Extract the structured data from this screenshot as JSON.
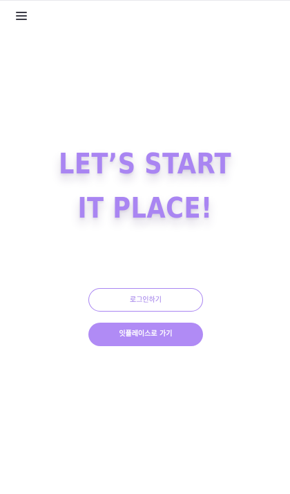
{
  "header": {
    "menu_icon": "hamburger-menu-icon"
  },
  "hero": {
    "line1": "LET’S START",
    "line2": "IT PLACE!"
  },
  "actions": {
    "login_label": "로그인하기",
    "go_label": "잇플레이스로 가기"
  },
  "colors": {
    "accent": "#a985f2",
    "button_fill": "#b08bf5",
    "icon": "#3a3a44"
  }
}
